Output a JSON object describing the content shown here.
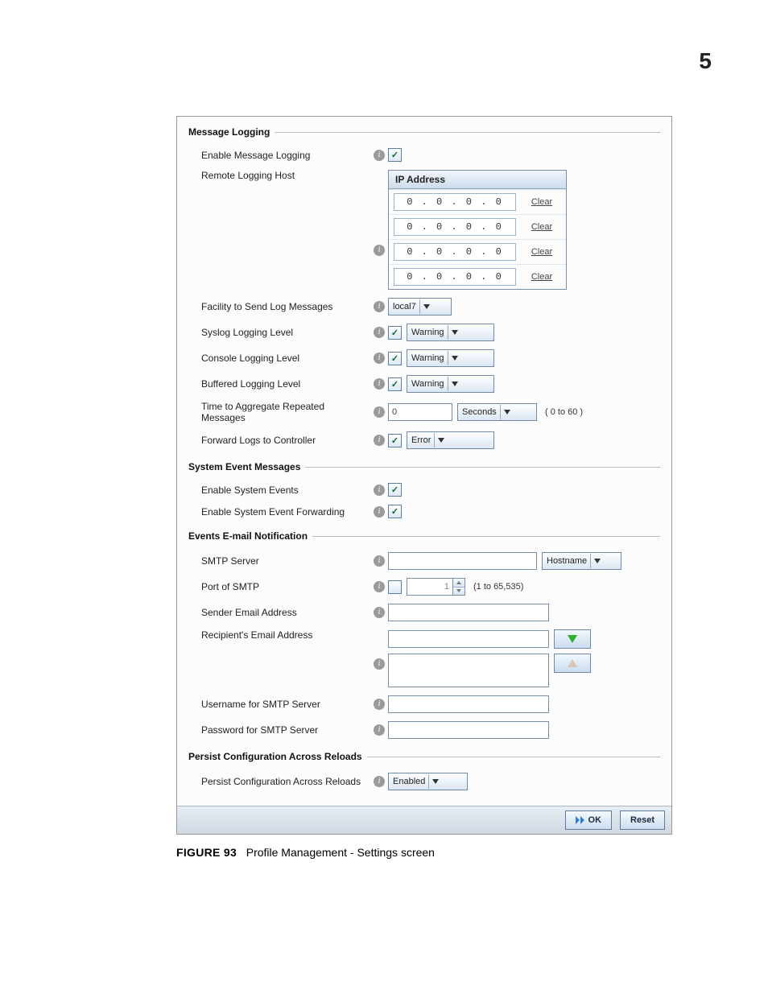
{
  "page_number": "5",
  "caption": {
    "figure": "FIGURE 93",
    "text": "Profile Management - Settings screen"
  },
  "sections": {
    "msg_log": {
      "title": "Message Logging",
      "enable_label": "Enable Message Logging",
      "enable_checked": true,
      "remote_host_label": "Remote Logging Host",
      "ip_header": "IP Address",
      "ip_rows": [
        {
          "ip": "0 . 0 . 0 . 0",
          "clear": "Clear"
        },
        {
          "ip": "0 . 0 . 0 . 0",
          "clear": "Clear"
        },
        {
          "ip": "0 . 0 . 0 . 0",
          "clear": "Clear"
        },
        {
          "ip": "0 . 0 . 0 . 0",
          "clear": "Clear"
        }
      ],
      "facility_label": "Facility to Send Log Messages",
      "facility_value": "local7",
      "syslog_level_label": "Syslog Logging Level",
      "syslog_level_checked": true,
      "syslog_level_value": "Warning",
      "console_level_label": "Console Logging Level",
      "console_level_checked": true,
      "console_level_value": "Warning",
      "buffered_level_label": "Buffered Logging Level",
      "buffered_level_checked": true,
      "buffered_level_value": "Warning",
      "aggregate_label": "Time to Aggregate Repeated Messages",
      "aggregate_value": "0",
      "aggregate_unit": "Seconds",
      "aggregate_range": "( 0 to 60 )",
      "forward_label": "Forward Logs to Controller",
      "forward_checked": true,
      "forward_value": "Error"
    },
    "sys_evt": {
      "title": "System Event Messages",
      "enable_events_label": "Enable System Events",
      "enable_events_checked": true,
      "enable_forward_label": "Enable System Event Forwarding",
      "enable_forward_checked": true
    },
    "email": {
      "title": "Events E-mail Notification",
      "smtp_server_label": "SMTP Server",
      "smtp_server_value": "",
      "smtp_type_value": "Hostname",
      "port_label": "Port of SMTP",
      "port_checked": false,
      "port_value": "1",
      "port_range": "(1 to 65,535)",
      "sender_label": "Sender Email Address",
      "sender_value": "",
      "recipient_label": "Recipient's Email Address",
      "recipient_input_value": "",
      "username_label": "Username for SMTP Server",
      "username_value": "",
      "password_label": "Password for SMTP Server",
      "password_value": ""
    },
    "persist": {
      "title": "Persist Configuration Across Reloads",
      "label": "Persist Configuration Across Reloads",
      "value": "Enabled"
    }
  },
  "footer": {
    "ok": "OK",
    "reset": "Reset"
  }
}
